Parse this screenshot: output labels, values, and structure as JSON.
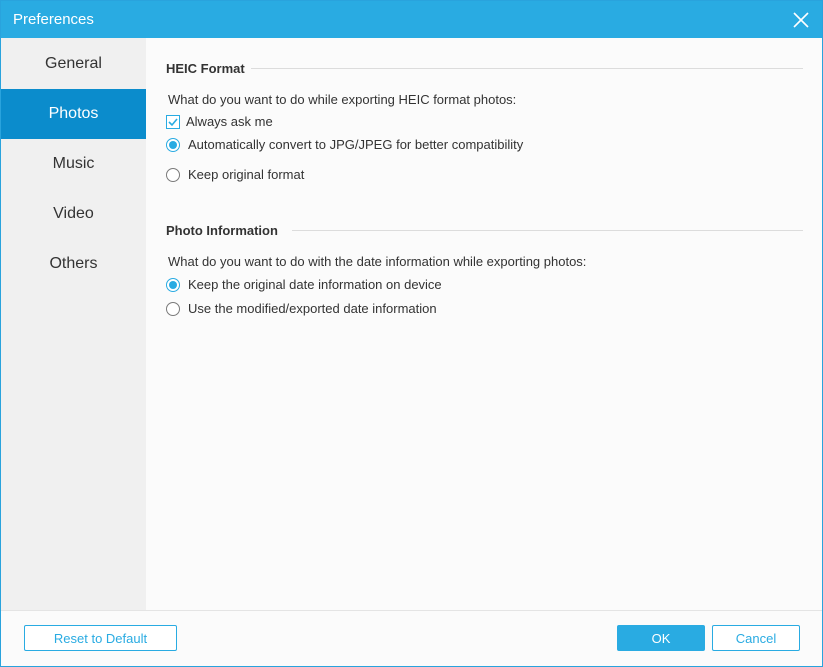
{
  "window": {
    "title": "Preferences",
    "close_icon": "close-icon"
  },
  "sidebar": {
    "items": [
      {
        "label": "General",
        "active": false
      },
      {
        "label": "Photos",
        "active": true
      },
      {
        "label": "Music",
        "active": false
      },
      {
        "label": "Video",
        "active": false
      },
      {
        "label": "Others",
        "active": false
      }
    ]
  },
  "heic": {
    "title": "HEIC Format",
    "question": "What do you want to do while exporting HEIC format photos:",
    "always_ask": {
      "label": "Always ask me",
      "checked": true
    },
    "options": [
      {
        "label": "Automatically convert to JPG/JPEG for better compatibility",
        "selected": true
      },
      {
        "label": "Keep original format",
        "selected": false
      }
    ]
  },
  "photo_info": {
    "title": "Photo Information",
    "question": "What do you want to do with the date information while exporting photos:",
    "options": [
      {
        "label": "Keep the original date information on device",
        "selected": true
      },
      {
        "label": "Use the modified/exported date information",
        "selected": false
      }
    ]
  },
  "footer": {
    "reset_label": "Reset to Default",
    "ok_label": "OK",
    "cancel_label": "Cancel"
  },
  "colors": {
    "accent": "#29abe2",
    "active_nav": "#0b8ccc",
    "sidebar_bg": "#f0f0f0"
  }
}
